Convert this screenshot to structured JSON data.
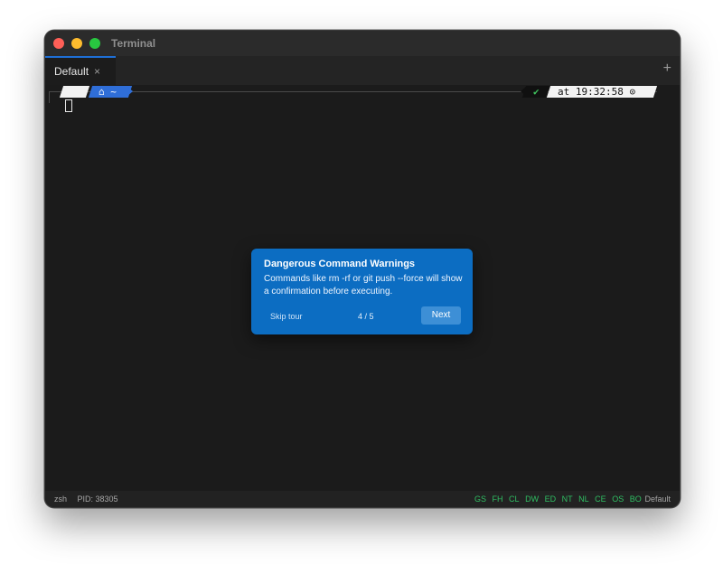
{
  "window": {
    "title": "Terminal"
  },
  "tabs": [
    {
      "label": "Default",
      "close": "×"
    }
  ],
  "new_tab": "+",
  "prompt": {
    "os_glyph": "",
    "dir_glyph": "⌂",
    "dir": "~",
    "status_glyph": "✔",
    "time_prefix": "at",
    "time": "19:32:58",
    "clock_glyph": "⊙"
  },
  "tour": {
    "title": "Dangerous Command Warnings",
    "body": "Commands like rm -rf or git push --force will show a confirmation before executing.",
    "skip": "Skip tour",
    "counter": "4 / 5",
    "next": "Next"
  },
  "status": {
    "shell": "zsh",
    "pid_label": "PID: 38305",
    "flags": [
      "GS",
      "FH",
      "CL",
      "DW",
      "ED",
      "NT",
      "NL",
      "CE",
      "OS",
      "BO"
    ],
    "profile": "Default"
  },
  "colors": {
    "accent": "#0c6dc2",
    "flag_green": "#2fbf63",
    "tab_indicator": "#1e6fd6"
  }
}
